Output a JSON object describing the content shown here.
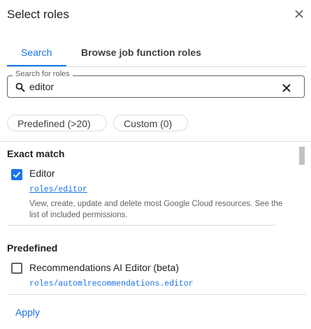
{
  "dialog": {
    "title": "Select roles",
    "close_icon": "close-icon"
  },
  "tabs": [
    {
      "label": "Search",
      "active": true
    },
    {
      "label": "Browse job function roles",
      "active": false
    }
  ],
  "search": {
    "label": "Search for roles",
    "value": "editor",
    "search_icon": "search-icon",
    "clear_icon": "clear-icon"
  },
  "filters": {
    "predefined_label": "Predefined (>20)",
    "custom_label": "Custom (0)"
  },
  "exact_match": {
    "heading": "Exact match",
    "role": {
      "name": "Editor",
      "id": "roles/editor",
      "description": "View, create, update and delete most Google Cloud resources. See the list of included permissions.",
      "checked": true
    }
  },
  "predefined": {
    "heading": "Predefined",
    "roles": [
      {
        "name": "Recommendations AI Editor (beta)",
        "id": "roles/automlrecommendations.editor",
        "checked": false
      }
    ]
  },
  "footer": {
    "apply_label": "Apply"
  },
  "colors": {
    "accent": "#1a73e8",
    "text": "#202124",
    "secondary_text": "#5f6368",
    "divider": "#dadce0"
  }
}
